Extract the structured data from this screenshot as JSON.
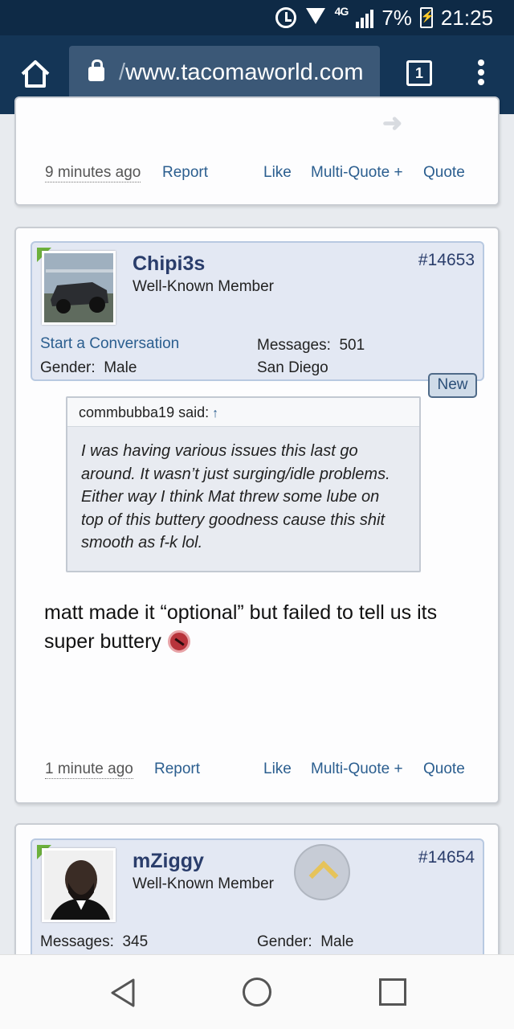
{
  "status_bar": {
    "network": "4G",
    "battery": "7%",
    "time": "21:25"
  },
  "browser": {
    "url_prefix": "/",
    "url_domain": "www.tacomaworld.com",
    "tab_count": "1"
  },
  "post_prev": {
    "time": "9 minutes ago",
    "report": "Report",
    "like": "Like",
    "multiquote": "Multi-Quote +",
    "quote": "Quote"
  },
  "post1": {
    "username": "Chipi3s",
    "user_title": "Well-Known Member",
    "post_number": "#14653",
    "start_conversation": "Start a Conversation",
    "messages_label": "Messages:",
    "messages_value": "501",
    "gender_label": "Gender:",
    "gender_value": "Male",
    "location": "San Diego",
    "new_badge": "New",
    "quote_author": "commbubba19 said:",
    "quote_arrow": "↑",
    "quote_text": "I was having various issues this last go around. It wasn’t just surging/idle problems. Either way I think Mat threw some lube on top of this buttery goodness cause this shit smooth as f-k lol.",
    "message": "matt made it “optional” but failed to tell us its super buttery",
    "time": "1 minute ago",
    "report": "Report",
    "like": "Like",
    "multiquote": "Multi-Quote +",
    "quote": "Quote"
  },
  "post2": {
    "username": "mZiggy",
    "user_title": "Well-Known Member",
    "post_number": "#14654",
    "messages_label": "Messages:",
    "messages_value": "345",
    "gender_label": "Gender:",
    "gender_value": "Male"
  },
  "colors": {
    "browser_bar": "#143556",
    "link": "#2b5e8f",
    "username": "#2a3d6b",
    "new_user_corner": "#6db13d"
  }
}
